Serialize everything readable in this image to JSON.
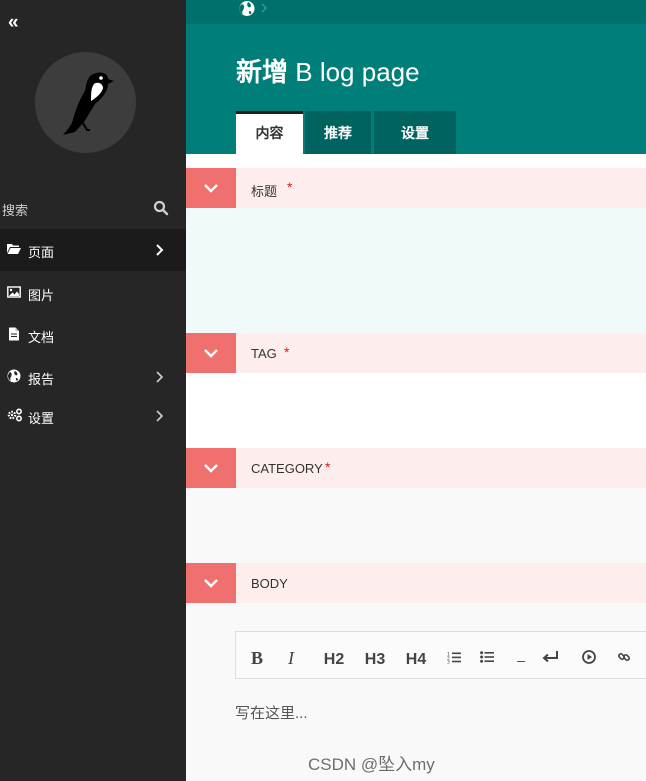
{
  "sidebar": {
    "search": {
      "label": "搜索",
      "icon": "search-icon"
    },
    "items": [
      {
        "label": "页面",
        "icon": "folder-open-icon",
        "active": true,
        "has_children": true
      },
      {
        "label": "图片",
        "icon": "image-icon",
        "active": false,
        "has_children": false
      },
      {
        "label": "文档",
        "icon": "document-icon",
        "active": false,
        "has_children": false
      },
      {
        "label": "报告",
        "icon": "globe-icon",
        "active": false,
        "has_children": true
      },
      {
        "label": "设置",
        "icon": "cogs-icon",
        "active": false,
        "has_children": true
      }
    ]
  },
  "header": {
    "title_action": "新增",
    "title_type": "B log page",
    "tabs": [
      {
        "label": "内容",
        "active": true
      },
      {
        "label": "推荐",
        "active": false
      },
      {
        "label": "设置",
        "active": false
      }
    ]
  },
  "panels": [
    {
      "label": "标题",
      "required": "*"
    },
    {
      "label": "TAG",
      "required": "*"
    },
    {
      "label": "CATEGORY",
      "required": "*"
    },
    {
      "label": "BODY",
      "required": ""
    }
  ],
  "editor": {
    "toolbar": {
      "bold": "B",
      "italic": "I",
      "h2": "H2",
      "h3": "H3",
      "h4": "H4",
      "hr": "–"
    },
    "placeholder": "写在这里..."
  },
  "watermark": "CSDN @坠入my",
  "colors": {
    "sidebar_bg": "#262626",
    "header_teal": "#007e7a",
    "tab_inactive": "#00635f",
    "panel_toggle": "#f07070",
    "panel_head_bg": "#fdeeed",
    "required_red": "#cc2222"
  }
}
